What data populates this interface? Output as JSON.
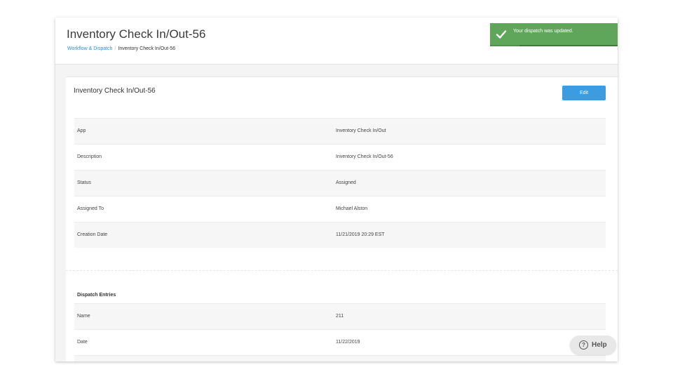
{
  "header": {
    "title": "Inventory Check In/Out-56",
    "breadcrumb": {
      "parent": "Workflow & Dispatch",
      "separator": "/",
      "current": "Inventory Check In/Out-56"
    }
  },
  "card": {
    "title": "Inventory Check In/Out-56",
    "edit_label": "Edit",
    "fields": [
      {
        "label": "App",
        "value": "Inventory Check In/Out"
      },
      {
        "label": "Description",
        "value": "Inventory Check In/Out-56"
      },
      {
        "label": "Status",
        "value": "Assigned"
      },
      {
        "label": "Assigned To",
        "value": "Michael Alston"
      },
      {
        "label": "Creation Date",
        "value": "11/21/2019 20:29 EST"
      }
    ]
  },
  "dispatch_entries": {
    "title": "Dispatch Entries",
    "fields": [
      {
        "label": "Name",
        "value": "211"
      },
      {
        "label": "Date",
        "value": "11/22/2019"
      }
    ]
  },
  "toast": {
    "message": "Your dispatch was updated.",
    "icon": "checkmark-icon",
    "progress": 0.77
  },
  "help": {
    "label": "Help",
    "icon": "question-circle-icon",
    "icon_glyph": "?"
  },
  "colors": {
    "accent": "#3d9be0",
    "link": "#2f8dd8",
    "toast_bg": "#5fa55a"
  }
}
